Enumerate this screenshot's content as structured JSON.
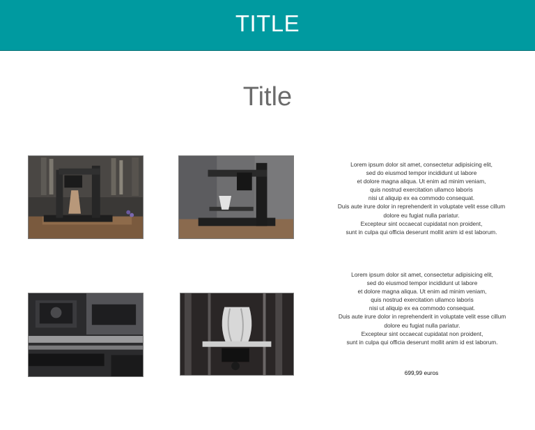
{
  "header": {
    "title": "TITLE"
  },
  "main": {
    "title": "Title",
    "products": [
      {
        "description": "Lorem ipsum dolor sit amet, consectetur adipisicing elit,\nsed do eiusmod tempor incididunt ut labore\net dolore magna aliqua. Ut enim ad minim veniam,\nquis nostrud exercitation ullamco laboris\nnisi ut aliquip ex ea commodo consequat.\nDuis aute irure dolor in reprehenderit in voluptate velit esse cillum\ndolore eu fugiat nulla pariatur.\nExcepteur sint occaecat cupidatat non proident,\nsunt in culpa qui officia deserunt mollit anim id est laborum."
      },
      {
        "description": "Lorem ipsum dolor sit amet, consectetur adipisicing elit,\nsed do eiusmod tempor incididunt ut labore\net dolore magna aliqua. Ut enim ad minim veniam,\nquis nostrud exercitation ullamco laboris\nnisi ut aliquip ex ea commodo consequat.\nDuis aute irure dolor in reprehenderit in voluptate velit esse cillum\ndolore eu fugiat nulla pariatur.\nExcepteur sint occaecat cupidatat non proident,\nsunt in culpa qui officia deserunt mollit anim id est laborum.",
        "price": "699,99 euros"
      }
    ]
  },
  "colors": {
    "header_bg": "#009aa0",
    "header_text": "#ffffff",
    "title_text": "#6b6b6b"
  }
}
